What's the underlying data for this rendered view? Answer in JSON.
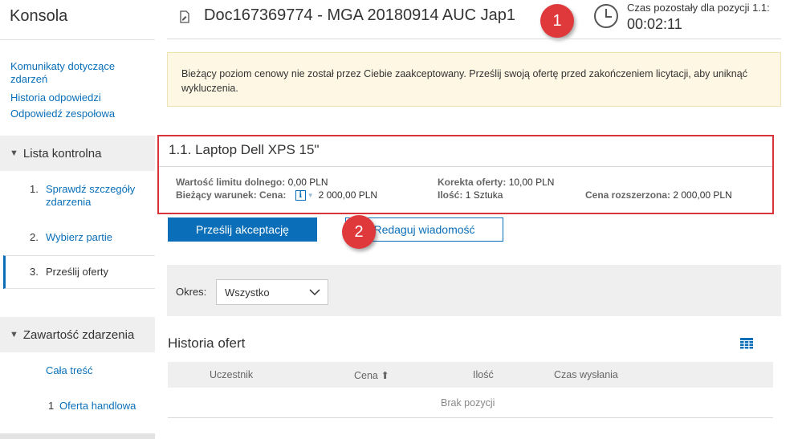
{
  "sidebar": {
    "brand": "Konsola",
    "links": [
      "Komunikaty dotyczące zdarzeń",
      "Historia odpowiedzi",
      "Odpowiedź zespołowa"
    ],
    "checklist_title": "Lista kontrolna",
    "steps": [
      {
        "num": "1.",
        "label": "Sprawdź szczegóły zdarzenia"
      },
      {
        "num": "2.",
        "label": "Wybierz partie"
      },
      {
        "num": "3.",
        "label": "Prześlij oferty"
      }
    ],
    "content_title": "Zawartość zdarzenia",
    "content_items": [
      {
        "num": "",
        "label": "Cała treść"
      },
      {
        "num": "1",
        "label": "Oferta handlowa"
      }
    ]
  },
  "header": {
    "title": "Doc167369774 - MGA 20180914 AUC Jap1",
    "timer_label": "Czas pozostały dla pozycji 1.1:",
    "timer_value": "00:02:11"
  },
  "callouts": [
    "1",
    "2"
  ],
  "warning": "Bieżący poziom cenowy nie został przez Ciebie zaakceptowany. Prześlij swoją ofertę przed zakończeniem licytacji, aby uniknąć wykluczenia.",
  "item": {
    "title": "1.1. Laptop Dell XPS 15\"",
    "lower_limit_label": "Wartość limitu dolnego:",
    "lower_limit_value": "0,00 PLN",
    "current_condition_label": "Bieżący warunek: Cena:",
    "current_condition_value": "2 000,00 PLN",
    "bid_correction_label": "Korekta oferty:",
    "bid_correction_value": "10,00 PLN",
    "quantity_label": "Ilość:",
    "quantity_value": "1 Sztuka",
    "extended_price_label": "Cena rozszerzona:",
    "extended_price_value": "2 000,00 PLN"
  },
  "actions": {
    "submit_label": "Prześlij akceptację",
    "edit_message_label": "Redaguj wiadomość"
  },
  "filter": {
    "label": "Okres:",
    "selected": "Wszystko"
  },
  "history": {
    "title": "Historia ofert",
    "columns": [
      "Uczestnik",
      "Cena ⬆",
      "Ilość",
      "Czas wysłania"
    ],
    "empty_text": "Brak pozycji"
  },
  "colors": {
    "accent": "#0a6fb8",
    "callout": "#e0393b",
    "highlight_border": "#d9343a",
    "warning_bg": "#fdf7e3"
  }
}
